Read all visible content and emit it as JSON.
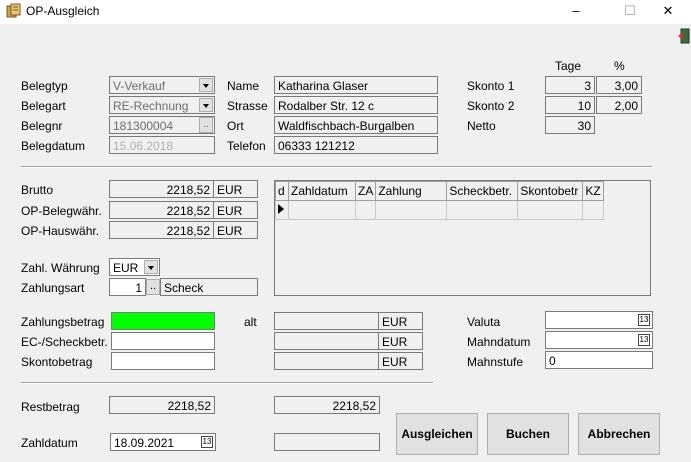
{
  "window": {
    "title": "OP-Ausgleich",
    "minimize": "–",
    "maximize": "☐",
    "close": "✕"
  },
  "customer": {
    "belegtyp_label": "Belegtyp",
    "belegtyp": "V-Verkauf",
    "belegart_label": "Belegart",
    "belegart": "RE-Rechnung",
    "belegnr_label": "Belegnr",
    "belegnr": "181300004",
    "belegdatum_label": "Belegdatum",
    "belegdatum": "15.06.2018",
    "name_label": "Name",
    "name": "Katharina Glaser",
    "strasse_label": "Strasse",
    "strasse": "Rodalber Str. 12 c",
    "ort_label": "Ort",
    "ort": "Waldfischbach-Burgalben",
    "telefon_label": "Telefon",
    "telefon": "06333 121212"
  },
  "terms": {
    "tage_header": "Tage",
    "pct_header": "%",
    "skonto1_label": "Skonto 1",
    "skonto1_tage": "3",
    "skonto1_pct": "3,00",
    "skonto2_label": "Skonto 2",
    "skonto2_tage": "10",
    "skonto2_pct": "2,00",
    "netto_label": "Netto",
    "netto_tage": "30"
  },
  "amounts": {
    "brutto_label": "Brutto",
    "brutto": "2218,52",
    "brutto_cur": "EUR",
    "beleg_label": "OP-Belegwähr.",
    "beleg": "2218,52",
    "beleg_cur": "EUR",
    "haus_label": "OP-Hauswähr.",
    "haus": "2218,52",
    "haus_cur": "EUR"
  },
  "payment": {
    "waehrung_label": "Zahl. Währung",
    "waehrung": "EUR",
    "zahlungsart_label": "Zahlungsart",
    "zahlungsart_nr": "1",
    "zahlungsart_btn": "..",
    "zahlungsart": "Scheck"
  },
  "grid": {
    "columns": [
      "d",
      "Zahldatum",
      "ZA",
      "Zahlung",
      "Scheckbetr.",
      "Skontobetr",
      "KZ"
    ]
  },
  "entry": {
    "zahlungsbetrag_label": "Zahlungsbetrag",
    "zahlungsbetrag": "",
    "scheck_label": "EC-/Scheckbetr.",
    "scheck": "",
    "skonto_label": "Skontobetrag",
    "skonto": "",
    "alt_label": "alt",
    "cur1": "EUR",
    "cur2": "EUR",
    "cur3": "EUR"
  },
  "dunning": {
    "valuta_label": "Valuta",
    "valuta": "",
    "mahndatum_label": "Mahndatum",
    "mahndatum": "",
    "mahnstufe_label": "Mahnstufe",
    "mahnstufe": "0"
  },
  "footer": {
    "restbetrag_label": "Restbetrag",
    "restbetrag": "2218,52",
    "restbetrag_right": "2218,52",
    "zahldatum_label": "Zahldatum",
    "zahldatum": "18.09.2021",
    "btn_ausgleichen": "Ausgleichen",
    "btn_buchen": "Buchen",
    "btn_abbrechen": "Abbrechen"
  },
  "colors": {
    "accent_green": "#00ff00"
  }
}
